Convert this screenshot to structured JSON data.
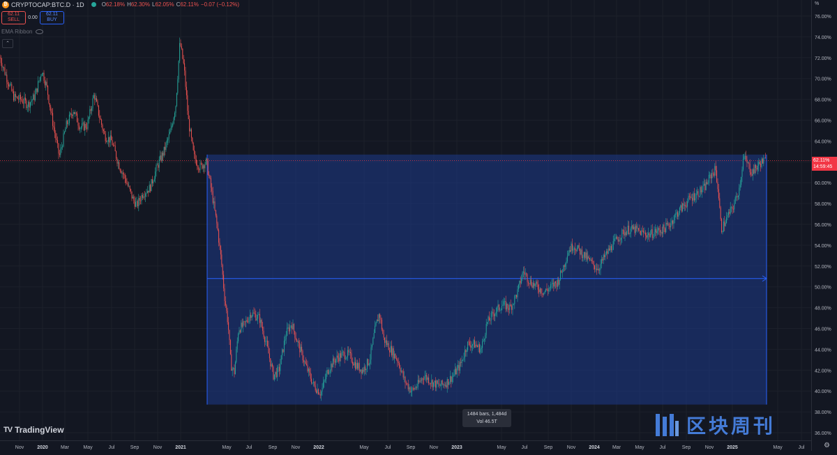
{
  "header": {
    "symbol": "CRYPTOCAP:BTC.D · 1D",
    "symbol_icon": "bitcoin-icon",
    "ohlc": [
      {
        "k": "O",
        "v": "62.18%"
      },
      {
        "k": "H",
        "v": "62.30%"
      },
      {
        "k": "L",
        "v": "62.05%"
      },
      {
        "k": "C",
        "v": "62.11%"
      }
    ],
    "change": "−0.07 (−0.12%)"
  },
  "trade": {
    "sell_price": "62.11",
    "sell_label": "SELL",
    "spread": "0.00",
    "buy_price": "62.11",
    "buy_label": "BUY"
  },
  "indicator": {
    "name": "EMA Ribbon"
  },
  "collapse_label": "⌃",
  "logo": {
    "text": "TradingView",
    "mark": "TV"
  },
  "watermark": {
    "text": "区块周刊"
  },
  "range_tooltip": {
    "line1": "1484 bars, 1,484d",
    "line2": "Vol 46.5T"
  },
  "price_axis": {
    "unit": "%",
    "current_value": "62.11%",
    "countdown": "14:59:45"
  },
  "colors": {
    "background": "#131722",
    "up": "#26a69a",
    "down": "#ef5350",
    "range_fill": "#1e3a8a",
    "range_line": "#2962ff",
    "current_line": "#f23645"
  },
  "chart_data": {
    "type": "candlestick",
    "ylim": [
      35.0,
      77.0
    ],
    "y_ticks": [
      "76.00%",
      "74.00%",
      "72.00%",
      "70.00%",
      "68.00%",
      "66.00%",
      "64.00%",
      "62.00%",
      "60.00%",
      "58.00%",
      "56.00%",
      "54.00%",
      "52.00%",
      "50.00%",
      "48.00%",
      "46.00%",
      "44.00%",
      "42.00%",
      "40.00%",
      "38.00%",
      "36.00%"
    ],
    "x_ticks": [
      "Nov",
      "2020",
      "Mar",
      "May",
      "Jul",
      "Sep",
      "Nov",
      "2021",
      "May",
      "Jul",
      "Sep",
      "Nov",
      "2022",
      "May",
      "Jul",
      "Sep",
      "Nov",
      "2023",
      "May",
      "Jul",
      "Sep",
      "Nov",
      "2024",
      "Mar",
      "May",
      "Jul",
      "Sep",
      "Nov",
      "2025",
      "May",
      "Jul"
    ],
    "current_value": 62.11,
    "series_path": [
      [
        0,
        72.0
      ],
      [
        10,
        70.0
      ],
      [
        20,
        68.2
      ],
      [
        30,
        68.0
      ],
      [
        40,
        67.5
      ],
      [
        50,
        68.3
      ],
      [
        60,
        70.8
      ],
      [
        67,
        69.2
      ],
      [
        75,
        66.0
      ],
      [
        85,
        62.5
      ],
      [
        95,
        65.5
      ],
      [
        105,
        67.0
      ],
      [
        115,
        65.3
      ],
      [
        125,
        65.5
      ],
      [
        135,
        68.5
      ],
      [
        142,
        66.5
      ],
      [
        150,
        64.5
      ],
      [
        160,
        64.0
      ],
      [
        170,
        61.8
      ],
      [
        180,
        60.3
      ],
      [
        190,
        58.5
      ],
      [
        196,
        57.8
      ],
      [
        205,
        59.0
      ],
      [
        215,
        59.5
      ],
      [
        225,
        61.5
      ],
      [
        235,
        63.0
      ],
      [
        245,
        65.0
      ],
      [
        252,
        67.5
      ],
      [
        258,
        73.5
      ],
      [
        264,
        71.0
      ],
      [
        270,
        66.0
      ],
      [
        278,
        62.5
      ],
      [
        286,
        61.5
      ],
      [
        296,
        62.0
      ],
      [
        305,
        58.5
      ],
      [
        312,
        55.5
      ],
      [
        318,
        52.0
      ],
      [
        322,
        49.0
      ],
      [
        327,
        46.5
      ],
      [
        331,
        42.5
      ],
      [
        336,
        41.8
      ],
      [
        342,
        46.0
      ],
      [
        350,
        46.3
      ],
      [
        360,
        47.5
      ],
      [
        372,
        47.0
      ],
      [
        382,
        44.5
      ],
      [
        392,
        41.5
      ],
      [
        400,
        42.0
      ],
      [
        410,
        45.5
      ],
      [
        418,
        46.5
      ],
      [
        425,
        45.0
      ],
      [
        438,
        42.5
      ],
      [
        450,
        40.5
      ],
      [
        460,
        39.8
      ],
      [
        470,
        42.0
      ],
      [
        480,
        43.0
      ],
      [
        490,
        43.5
      ],
      [
        500,
        43.5
      ],
      [
        510,
        42.5
      ],
      [
        520,
        42.0
      ],
      [
        530,
        43.0
      ],
      [
        538,
        46.0
      ],
      [
        544,
        47.5
      ],
      [
        550,
        45.0
      ],
      [
        560,
        44.0
      ],
      [
        570,
        43.0
      ],
      [
        580,
        41.0
      ],
      [
        590,
        40.0
      ],
      [
        598,
        40.5
      ],
      [
        608,
        41.5
      ],
      [
        620,
        40.8
      ],
      [
        630,
        40.5
      ],
      [
        640,
        40.8
      ],
      [
        650,
        41.5
      ],
      [
        660,
        42.5
      ],
      [
        670,
        44.5
      ],
      [
        680,
        44.5
      ],
      [
        690,
        44.0
      ],
      [
        698,
        46.5
      ],
      [
        708,
        47.5
      ],
      [
        720,
        48.3
      ],
      [
        732,
        48.0
      ],
      [
        742,
        49.5
      ],
      [
        750,
        51.5
      ],
      [
        760,
        50.5
      ],
      [
        770,
        50.0
      ],
      [
        780,
        49.5
      ],
      [
        790,
        50.0
      ],
      [
        800,
        50.5
      ],
      [
        808,
        52.0
      ],
      [
        815,
        53.5
      ],
      [
        822,
        54.0
      ],
      [
        830,
        53.5
      ],
      [
        838,
        53.0
      ],
      [
        845,
        52.5
      ],
      [
        852,
        52.0
      ],
      [
        858,
        51.8
      ],
      [
        868,
        53.0
      ],
      [
        878,
        54.0
      ],
      [
        890,
        55.0
      ],
      [
        900,
        55.5
      ],
      [
        910,
        55.5
      ],
      [
        920,
        55.2
      ],
      [
        930,
        55.0
      ],
      [
        940,
        55.3
      ],
      [
        950,
        55.5
      ],
      [
        960,
        56.0
      ],
      [
        970,
        57.0
      ],
      [
        980,
        57.8
      ],
      [
        990,
        58.5
      ],
      [
        1000,
        59.0
      ],
      [
        1010,
        59.5
      ],
      [
        1020,
        60.8
      ],
      [
        1026,
        61.3
      ],
      [
        1030,
        59.0
      ],
      [
        1034,
        55.5
      ],
      [
        1038,
        56.0
      ],
      [
        1045,
        57.0
      ],
      [
        1052,
        57.8
      ],
      [
        1060,
        59.5
      ],
      [
        1066,
        62.5
      ],
      [
        1070,
        62.0
      ],
      [
        1078,
        61.0
      ],
      [
        1085,
        61.5
      ],
      [
        1092,
        62.0
      ],
      [
        1098,
        62.11
      ]
    ],
    "measure_range": {
      "start_value": 62.7,
      "end_value": 38.7,
      "mid_value": 50.8,
      "bars": 1484,
      "days": 1484,
      "volume": "46.5T"
    }
  }
}
